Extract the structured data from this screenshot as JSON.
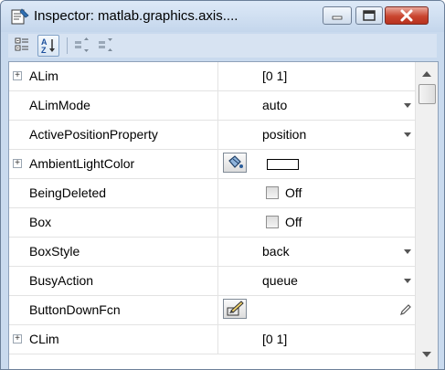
{
  "window": {
    "title": "Inspector:  matlab.graphics.axis....",
    "app_icon": "inspector-icon"
  },
  "toolbar": {
    "buttons": [
      {
        "name": "categorized-view",
        "icon": "categorized-icon",
        "active": false
      },
      {
        "name": "alphabetical-view",
        "icon": "sort-az-icon",
        "active": true
      },
      {
        "name": "expand-all",
        "icon": "expand-all-icon",
        "active": false
      },
      {
        "name": "collapse-all",
        "icon": "collapse-all-icon",
        "active": false
      }
    ]
  },
  "properties": [
    {
      "name": "ALim",
      "expandable": true,
      "value": "[0 1]",
      "kind": "text"
    },
    {
      "name": "ALimMode",
      "expandable": false,
      "value": "auto",
      "kind": "dropdown"
    },
    {
      "name": "ActivePositionProperty",
      "expandable": false,
      "value": "position",
      "kind": "dropdown"
    },
    {
      "name": "AmbientLightColor",
      "expandable": true,
      "value": "",
      "kind": "color",
      "color": "#ffffff"
    },
    {
      "name": "BeingDeleted",
      "expandable": false,
      "value": "Off",
      "kind": "checkbox"
    },
    {
      "name": "Box",
      "expandable": false,
      "value": "Off",
      "kind": "checkbox"
    },
    {
      "name": "BoxStyle",
      "expandable": false,
      "value": "back",
      "kind": "dropdown"
    },
    {
      "name": "BusyAction",
      "expandable": false,
      "value": "queue",
      "kind": "dropdown"
    },
    {
      "name": "ButtonDownFcn",
      "expandable": false,
      "value": "",
      "kind": "callback"
    },
    {
      "name": "CLim",
      "expandable": true,
      "value": "[0 1]",
      "kind": "text"
    }
  ],
  "colors": {
    "frame": "#c9daee",
    "close_button": "#c9452f",
    "grid_line": "#e3e3e3"
  }
}
